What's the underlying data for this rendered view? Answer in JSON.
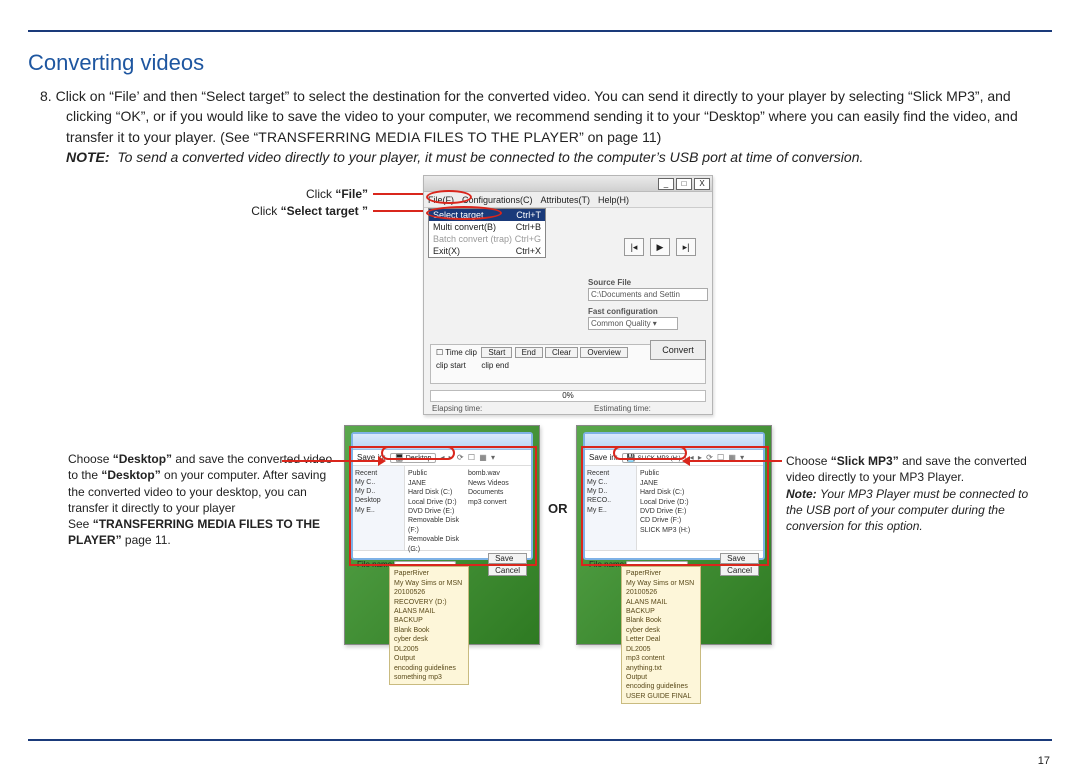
{
  "page": {
    "number": "17",
    "title": "Converting videos"
  },
  "step": {
    "number": "8.",
    "body_part1": "Click on “",
    "file_word": "File",
    "body_part2": "’ and then “",
    "select_target_word": "Select target",
    "body_part3": "” to select the destination for the converted video.  You can send it directly to your player by selecting “",
    "slick_word": "Slick MP3",
    "body_part4": "”, and clicking “",
    "ok_word": "OK",
    "body_part5": "”, or if you would like to save the video to your computer, we recommend sending it to your “",
    "desktop_word": "Desktop",
    "body_part6": "” where you can easily find the video, and transfer it to your player. (See “",
    "transfer_ref": "TRANSFERRING MEDIA FILES TO THE PLAYER",
    "body_part7": "” on page 11)"
  },
  "note": {
    "label": "NOTE:",
    "body": "To send a converted video directly to your player, it must be connected  to the computer’s USB port at time of conversion."
  },
  "callouts": {
    "file_label_pre": "Click ",
    "file_label_bold": "“File”",
    "select_label_pre": "Click ",
    "select_label_bold": "“Select target ”"
  },
  "app": {
    "menu": {
      "file": "File(F)",
      "config": "Configurations(C)",
      "attributes": "Attributes(T)",
      "help": "Help(H)"
    },
    "dropdown": {
      "select_target": "Select target",
      "select_target_sc": "Ctrl+T",
      "multi_convert": "Multi convert(B)",
      "multi_convert_sc": "Ctrl+B",
      "batch_convert": "Batch convert (trap)",
      "batch_convert_sc": "Ctrl+G",
      "exit": "Exit(X)",
      "exit_sc": "Ctrl+X"
    },
    "right": {
      "source_lbl": "Source File",
      "source_val": "C:\\Documents and Settin",
      "fast_lbl": "Fast configuration",
      "combo": "Common Quality"
    },
    "clip": {
      "timeclip": "Time clip",
      "start": "Start",
      "end": "End",
      "clear": "Clear",
      "overview": "Overview",
      "clip_start": "clip start",
      "clip_end": "clip end"
    },
    "convert": "Convert",
    "progress": "0%",
    "elapsing": "Elapsing time:",
    "estimating": "Estimating time:"
  },
  "ss": {
    "desktop_pill": "Desktop",
    "slick_pill": "SLICK MP3 (H:)",
    "savein": "Save in:",
    "filename": "File name:",
    "save": "Save",
    "cancel": "Cancel",
    "side": [
      "Recent",
      "My C..",
      "My D..",
      "Desktop",
      "My E.."
    ],
    "main_desktop": [
      "Public",
      "JANE",
      "Hard Disk (C:)",
      "Local Drive (D:)",
      "DVD Drive (E:)",
      "Removable Disk (F:)",
      "Removable Disk (G:)"
    ],
    "main_right": [
      "bomb.wav",
      "News Videos",
      "Documents",
      "mp3 convert"
    ],
    "main_slick": [
      "Public",
      "JANE",
      "Hard Disk (C:)",
      "Local Drive (D:)",
      "DVD Drive (E:)",
      "CD Drive (F:)",
      "SLICK MP3 (H:)"
    ],
    "list": [
      "PaperRiver",
      "My Way Sims or MSN",
      "20100526",
      "RECOVERY (D:)",
      "ALANS MAIL BACKUP",
      "Blank Book",
      "cyber desk",
      "DL2005",
      "Output",
      "encoding guidelines",
      "something mp3"
    ],
    "list2": [
      "PaperRiver",
      "My Way Sims or MSN",
      "20100526",
      "ALANS MAIL BACKUP",
      "Blank Book",
      "cyber desk",
      "Letter Deal",
      "DL2005",
      "mp3 content",
      "anything.txt",
      "Output",
      "encoding guidelines",
      "USER GUIDE FINAL"
    ]
  },
  "left_text": {
    "line1_pre": "Choose ",
    "line1_bold": "“Desktop”",
    "line1_post": " and save the converted video to the ",
    "line2_bold": "“Desktop”",
    "line2_post": " on your computer.  After saving the converted video to your desktop, you can transfer it directly to your player",
    "line3_pre": "See ",
    "line3_bold": "“TRANSFERRING MEDIA FILES TO THE PLAYER”",
    "line3_post": " page 11."
  },
  "right_text": {
    "line1_pre": "Choose  ",
    "line1_bold": "“Slick MP3”",
    "line1_post": " and save the converted video directly  to your MP3 Player.",
    "note_pre": "Note: ",
    "note_body": "Your MP3  Player must be  connected to the USB port of your computer during the conversion for this option."
  },
  "or_label": "OR"
}
